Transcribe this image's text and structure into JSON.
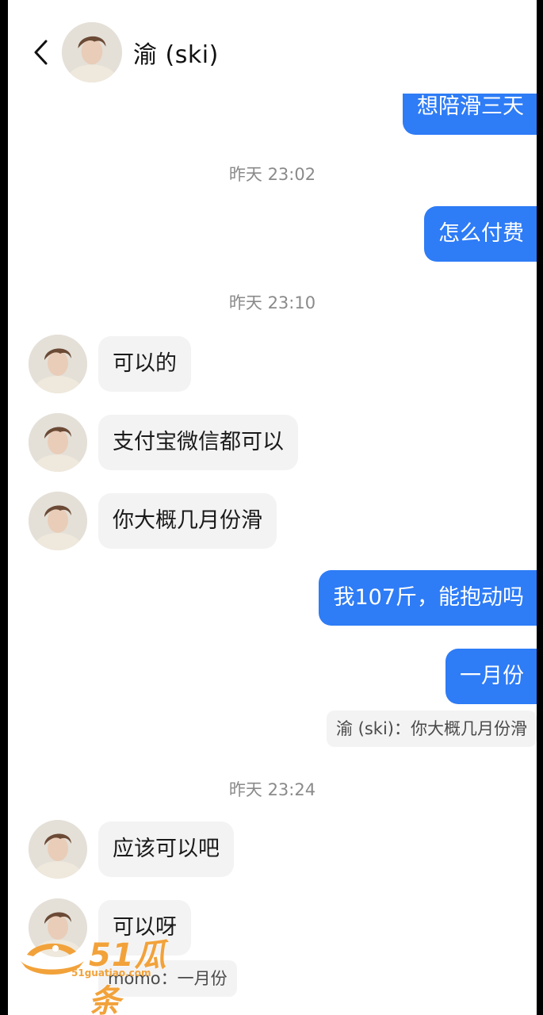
{
  "header": {
    "title": "渝 (ski)",
    "back_icon": "chevron-left-icon"
  },
  "messages": {
    "out_partial": "想陪滑三天",
    "ts1": "昨天 23:02",
    "out1": "怎么付费",
    "ts2": "昨天 23:10",
    "in1": "可以的",
    "in2": "支付宝微信都可以",
    "in3": "你大概几月份滑",
    "out2": "我107斤，能抱动吗",
    "out3": "一月份",
    "quote1": "渝 (ski)：你大概几月份滑",
    "ts3": "昨天 23:24",
    "in4": "应该可以吧",
    "in5": "可以呀",
    "quote2": "momo：一月份"
  },
  "watermark": {
    "text": "51瓜条",
    "sub": "51guatiao.com"
  },
  "colors": {
    "outgoing_bubble": "#2e7cf6",
    "incoming_bubble": "#f3f3f3",
    "timestamp": "#8a8a8a"
  }
}
